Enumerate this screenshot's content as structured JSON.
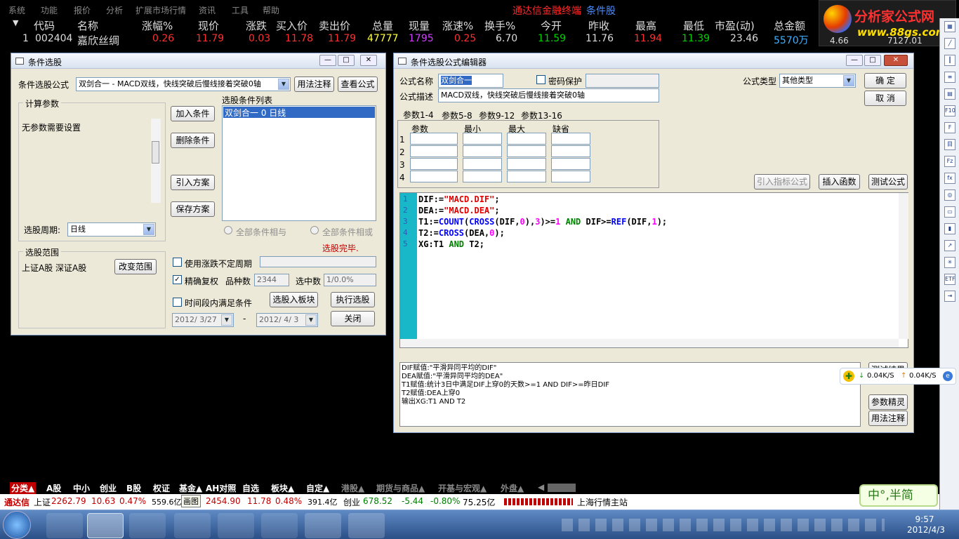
{
  "menu": [
    "系统",
    "功能",
    "报价",
    "分析",
    "扩展市场行情",
    "资讯",
    "工具",
    "帮助"
  ],
  "brand": "通达信金融终端",
  "brand_sub": "条件股",
  "logo": {
    "title": "分析家公式网",
    "url": "www.88gs.com"
  },
  "quote_header": {
    "arrow": "▼",
    "cols": [
      "代码",
      "名称",
      "涨幅%",
      "现价",
      "涨跌",
      "买入价",
      "卖出价",
      "总量",
      "现量",
      "涨速%",
      "换手%",
      "今开",
      "昨收",
      "最高",
      "最低",
      "市盈(动)",
      "总金额"
    ]
  },
  "quote_row": {
    "idx": "1",
    "code": "002404",
    "name": "嘉欣丝绸",
    "chg_pct": "0.26",
    "price": "11.79",
    "chg": "0.03",
    "bid": "11.78",
    "ask": "11.79",
    "volume": "47777",
    "cur_vol": "1795",
    "speed": "0.25",
    "turnover": "6.70",
    "open": "11.59",
    "prev_close": "11.76",
    "high": "11.94",
    "low": "11.39",
    "pe": "23.46",
    "amount": "5570万",
    "extra1": "4.66",
    "extra2": "7127.01"
  },
  "selector": {
    "title": "条件选股",
    "formula_label": "条件选股公式",
    "formula_value": "双剑合一 - MACD双线，快线突破后慢线接着突破0轴",
    "btn_usage": "用法注释",
    "btn_view": "查看公式",
    "params_group": "计算参数",
    "params_text": "无参数需要设置",
    "btn_add": "加入条件",
    "btn_delete": "删除条件",
    "btn_import": "引入方案",
    "btn_save": "保存方案",
    "list_label": "选股条件列表",
    "list_items": [
      "双剑合一  0  日线"
    ],
    "period_label": "选股周期:",
    "period_value": "日线",
    "radio_and": "全部条件相与",
    "radio_or": "全部条件相或",
    "done_text": "选股完毕.",
    "range_group": "选股范围",
    "range_value": "上证A股  深证A股",
    "btn_change_range": "改变范围",
    "chk_unfixed": "使用涨跌不定周期",
    "chk_exact": "精确复权",
    "count_label": "品种数",
    "count_value": "2344",
    "selected_label": "选中数",
    "selected_value": "1/0.0%",
    "chk_timespan": "时间段内满足条件",
    "btn_to_block": "选股入板块",
    "btn_execute": "执行选股",
    "date_from": "2012/ 3/27",
    "date_sep": "-",
    "date_to": "2012/ 4/ 3",
    "btn_close": "关闭"
  },
  "editor": {
    "title": "条件选股公式编辑器",
    "name_label": "公式名称",
    "name_value": "双剑合一",
    "pwd_label": "密码保护",
    "type_label": "公式类型",
    "type_value": "其他类型",
    "btn_ok": "确  定",
    "btn_cancel": "取  消",
    "desc_label": "公式描述",
    "desc_value": "MACD双线，快线突破后慢线接着突破0轴",
    "tabs": [
      "参数1-4",
      "参数5-8",
      "参数9-12",
      "参数13-16"
    ],
    "param_cols": [
      "参数",
      "最小",
      "最大",
      "缺省"
    ],
    "param_rows": [
      "1",
      "2",
      "3",
      "4"
    ],
    "btn_import_indicator": "引入指标公式",
    "btn_insert_func": "插入函数",
    "btn_test": "测试公式",
    "code_lines": [
      "1",
      "2",
      "3",
      "4",
      "5"
    ],
    "notes": "DIF赋值:\"平滑异同平均的DIF\"\nDEA赋值:\"平滑异同平均的DEA\"\nT1赋值:统计3日中满足DIF上穿0的天数>=1 AND DIF>=昨日DIF\nT2赋值:DEA上穿0\n输出XG:T1 AND T2",
    "btn_check_result": "测试结果",
    "btn_param_wizard": "参数精灵",
    "btn_usage": "用法注释"
  },
  "speed_widget": {
    "down": "0.04K/S",
    "up": "0.04K/S"
  },
  "bottom_tabs": [
    "分类▲",
    "A股",
    "中小",
    "创业",
    "B股",
    "权证",
    "基金▲",
    "AH对照",
    "自选",
    "板块▲",
    "自定▲",
    "港股▲",
    "期货与商品▲",
    "开基与宏观▲",
    "外盘▲"
  ],
  "status": {
    "brand": "通达信",
    "sh_label": "上证",
    "sh_index": "2262.79",
    "sh_chg": "10.63",
    "sh_pct": "0.47%",
    "sh_amt": "559.6亿",
    "tooltip": "画图",
    "sz_index": "2454.90",
    "sz_chg": "11.78",
    "sz_pct": "0.48%",
    "sz_amt": "391.4亿",
    "cy_label": "创业",
    "cy_index": "678.52",
    "cy_chg": "-5.44",
    "cy_pct": "-0.80%",
    "cy_amt": "75.25亿",
    "station": "上海行情主站"
  },
  "ime": "中°,半简",
  "clock": {
    "time": "9:57",
    "date": "2012/4/3"
  },
  "colors": {
    "up": "#ff3030",
    "down": "#00d000",
    "accent": "#0054e3"
  }
}
